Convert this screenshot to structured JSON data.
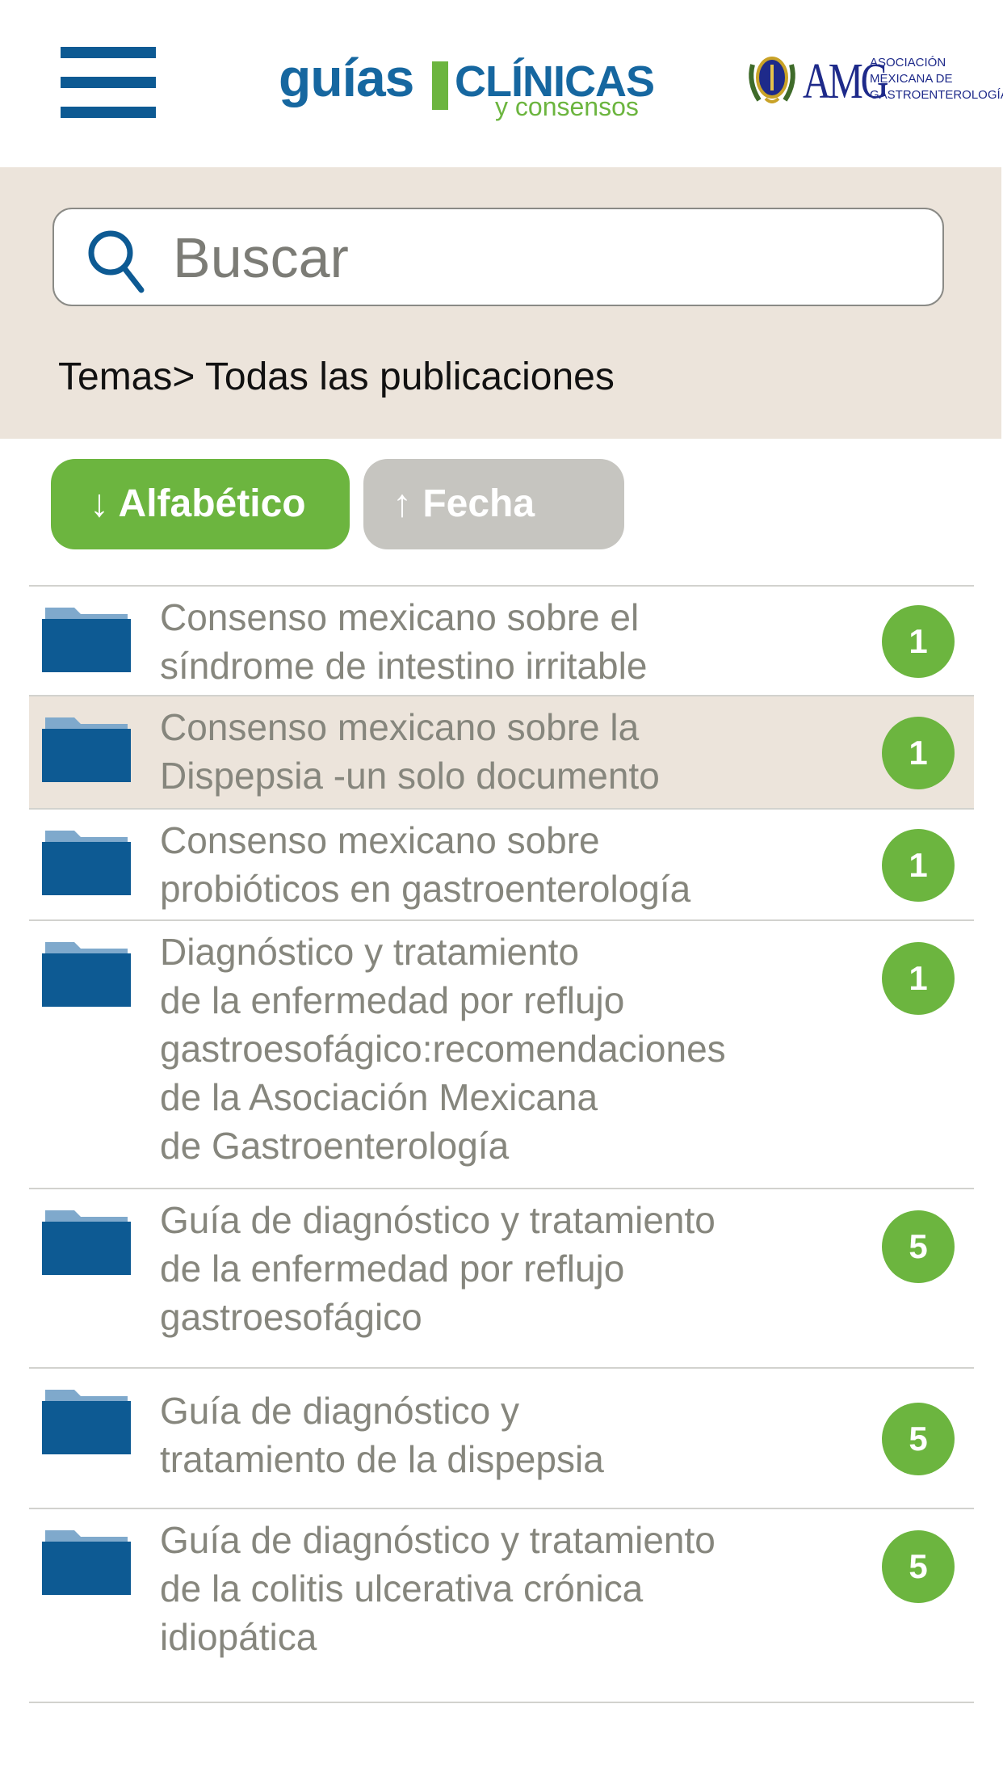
{
  "header": {
    "menu_icon": "hamburger-menu-icon",
    "logo": {
      "word1": "guías",
      "word2": "CLÍNICAS",
      "tagline": "y consensos"
    },
    "partner": {
      "acronym": "AMG",
      "full_name": [
        "ASOCIACIÓN",
        "MEXICANA DE",
        "GASTROENTEROLOGÍA"
      ]
    }
  },
  "search": {
    "placeholder": "Buscar",
    "value": "",
    "icon": "search-icon"
  },
  "breadcrumb": "Temas> Todas las publicaciones",
  "sort": {
    "alphabetical": {
      "label": "↓ Alfabético",
      "active": true
    },
    "date": {
      "label": "↑ Fecha",
      "active": false
    }
  },
  "colors": {
    "brand_blue": "#0d5a93",
    "accent_green": "#6cb53f",
    "panel_beige": "#ece4db",
    "inactive_gray": "#c6c5c0",
    "text_gray": "#86867d"
  },
  "items": [
    {
      "icon": "folder-icon",
      "lines": [
        "Consenso mexicano sobre el",
        "síndrome de intestino irritable"
      ],
      "count": "1",
      "selected": false
    },
    {
      "icon": "folder-icon",
      "lines": [
        "Consenso mexicano sobre la",
        "Dispepsia -un solo documento"
      ],
      "count": "1",
      "selected": true
    },
    {
      "icon": "folder-icon",
      "lines": [
        "Consenso mexicano sobre",
        "probióticos en gastroenterología"
      ],
      "count": "1",
      "selected": false
    },
    {
      "icon": "folder-icon",
      "lines": [
        "Diagnóstico y tratamiento",
        "de la enfermedad por reflujo",
        "gastroesofágico:recomendaciones",
        "de la Asociación Mexicana",
        "de Gastroenterología"
      ],
      "count": "1",
      "selected": false
    },
    {
      "icon": "folder-icon",
      "lines": [
        "Guía de diagnóstico y tratamiento",
        "de la enfermedad por reflujo",
        "gastroesofágico"
      ],
      "count": "5",
      "selected": false
    },
    {
      "icon": "folder-icon",
      "lines": [
        "Guía de diagnóstico y",
        "tratamiento de la dispepsia"
      ],
      "count": "5",
      "selected": false
    },
    {
      "icon": "folder-icon",
      "lines": [
        "Guía de diagnóstico y tratamiento",
        "de la colitis ulcerativa crónica",
        "idiopática"
      ],
      "count": "5",
      "selected": false
    }
  ]
}
